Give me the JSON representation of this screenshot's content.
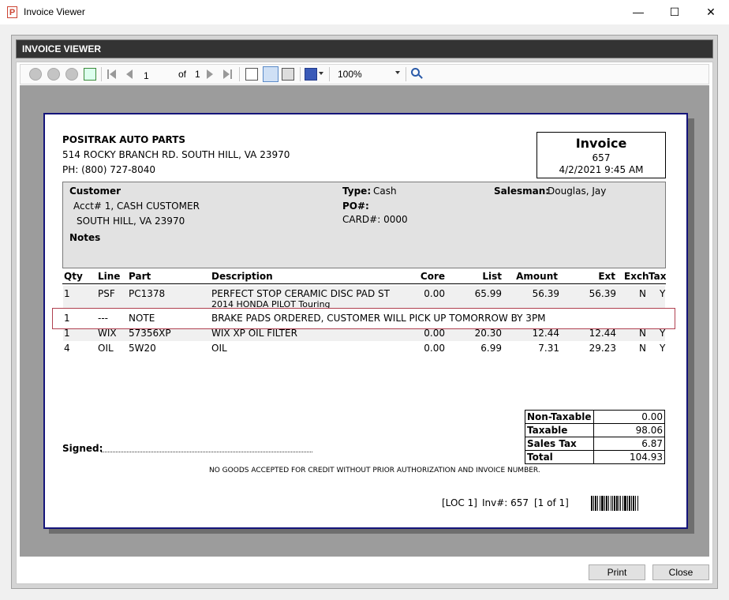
{
  "window": {
    "title": "Invoice Viewer",
    "app_icon_letter": "P",
    "minimize_glyph": "—",
    "maximize_glyph": "☐",
    "close_glyph": "✕"
  },
  "header": {
    "title": "INVOICE VIEWER"
  },
  "toolbar": {
    "page_current": "1",
    "page_of_label": "of",
    "page_total": "1",
    "zoom": "100%",
    "icons": [
      "back-icon",
      "forward-icon",
      "stop-icon",
      "refresh-icon",
      "first-page-icon",
      "previous-page-icon",
      "next-page-icon",
      "last-page-icon",
      "document-map-icon",
      "print-layout-icon",
      "print-icon",
      "export-save-icon",
      "search-icon"
    ]
  },
  "invoice": {
    "company": {
      "name": "POSITRAK AUTO PARTS",
      "address": "514 ROCKY BRANCH RD.  SOUTH HILL, VA 23970",
      "phone": "PH: (800) 727-8040"
    },
    "box": {
      "title": "Invoice",
      "number": "657",
      "datetime": "4/2/2021 9:45 AM"
    },
    "customer": {
      "label": "Customer",
      "account": "Acct# 1, CASH CUSTOMER",
      "city": "SOUTH HILL, VA 23970",
      "notes_label": "Notes",
      "type_label": "Type:",
      "type_value": "Cash",
      "po_label": "PO#:",
      "card": "CARD#: 0000",
      "salesman_label": "Salesman:",
      "salesman_value": "Douglas, Jay"
    },
    "columns": [
      "Qty",
      "Line",
      "Part",
      "Description",
      "Core",
      "List",
      "Amount",
      "Ext",
      "Exch",
      "Tax"
    ],
    "rows": [
      {
        "qty": "1",
        "line": "PSF",
        "part": "PC1378",
        "description": "PERFECT STOP CERAMIC DISC PAD ST",
        "description2": "2014 HONDA PILOT Touring",
        "core": "0.00",
        "list": "65.99",
        "amount": "56.39",
        "ext": "56.39",
        "exch": "N",
        "tax": "Y"
      },
      {
        "qty": "1",
        "line": "---",
        "part": "NOTE",
        "description": "BRAKE PADS ORDERED, CUSTOMER WILL PICK UP TOMORROW BY 3PM"
      },
      {
        "qty": "1",
        "line": "WIX",
        "part": "57356XP",
        "description": "WIX XP  OIL FILTER",
        "core": "0.00",
        "list": "20.30",
        "amount": "12.44",
        "ext": "12.44",
        "exch": "N",
        "tax": "Y"
      },
      {
        "qty": "4",
        "line": "OIL",
        "part": "5W20",
        "description": "OIL",
        "core": "0.00",
        "list": "6.99",
        "amount": "7.31",
        "ext": "29.23",
        "exch": "N",
        "tax": "Y"
      }
    ],
    "totals": [
      {
        "label": "Non-Taxable",
        "value": "0.00"
      },
      {
        "label": "Taxable",
        "value": "98.06"
      },
      {
        "label": "Sales Tax",
        "value": "6.87"
      },
      {
        "label": "Total",
        "value": "104.93"
      }
    ],
    "signed_label": "Signed:",
    "disclaimer": "NO GOODS ACCEPTED FOR CREDIT WITHOUT PRIOR AUTHORIZATION AND INVOICE NUMBER.",
    "footer": {
      "location": "[LOC 1]",
      "inv": "Inv#: 657",
      "page": "[1 of 1]"
    }
  },
  "buttons": {
    "print": "Print",
    "close": "Close"
  },
  "colors": {
    "header_bar": "#333333",
    "page_border": "#14147a",
    "note_highlight": "#b04050"
  }
}
